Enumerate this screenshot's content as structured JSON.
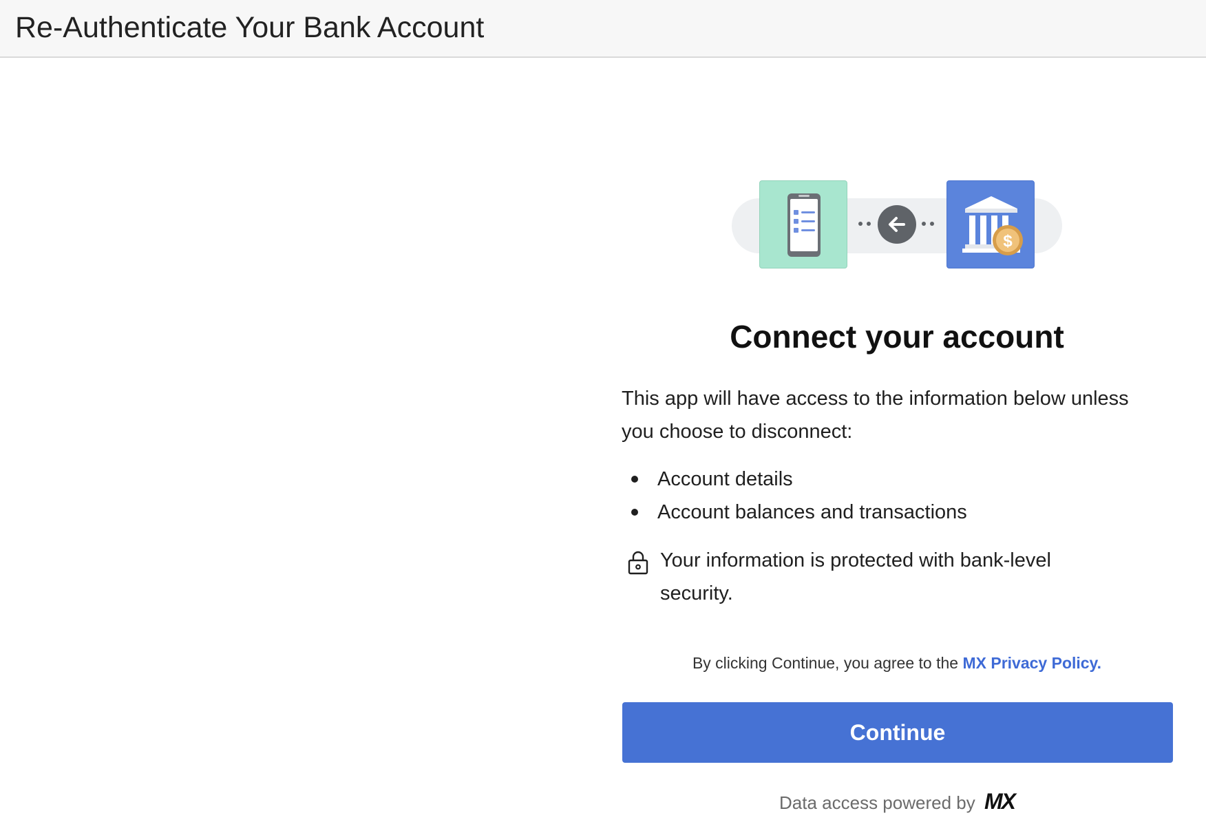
{
  "header": {
    "title": "Re-Authenticate Your Bank Account"
  },
  "hero": {
    "left_icon": "phone-list-icon",
    "center_icon": "arrow-left-icon",
    "right_icon": "bank-coin-icon",
    "colors": {
      "app_tile": "#a8e6cf",
      "bank_tile": "#5b84dc",
      "coin": "#e8b96a"
    }
  },
  "main": {
    "title": "Connect your account",
    "description": "This app will have access to the information below unless you choose to disconnect:",
    "access_items": [
      "Account details",
      "Account balances and transactions"
    ],
    "security_icon": "lock-icon",
    "security_note": "Your information is protected with bank-level security.",
    "consent_prefix": "By clicking Continue, you agree to the ",
    "consent_link": "MX Privacy Policy.",
    "continue_label": "Continue",
    "powered_by": "Data access powered by",
    "powered_logo": "MX"
  },
  "colors": {
    "accent": "#4672d4",
    "link": "#3e6ad6"
  }
}
